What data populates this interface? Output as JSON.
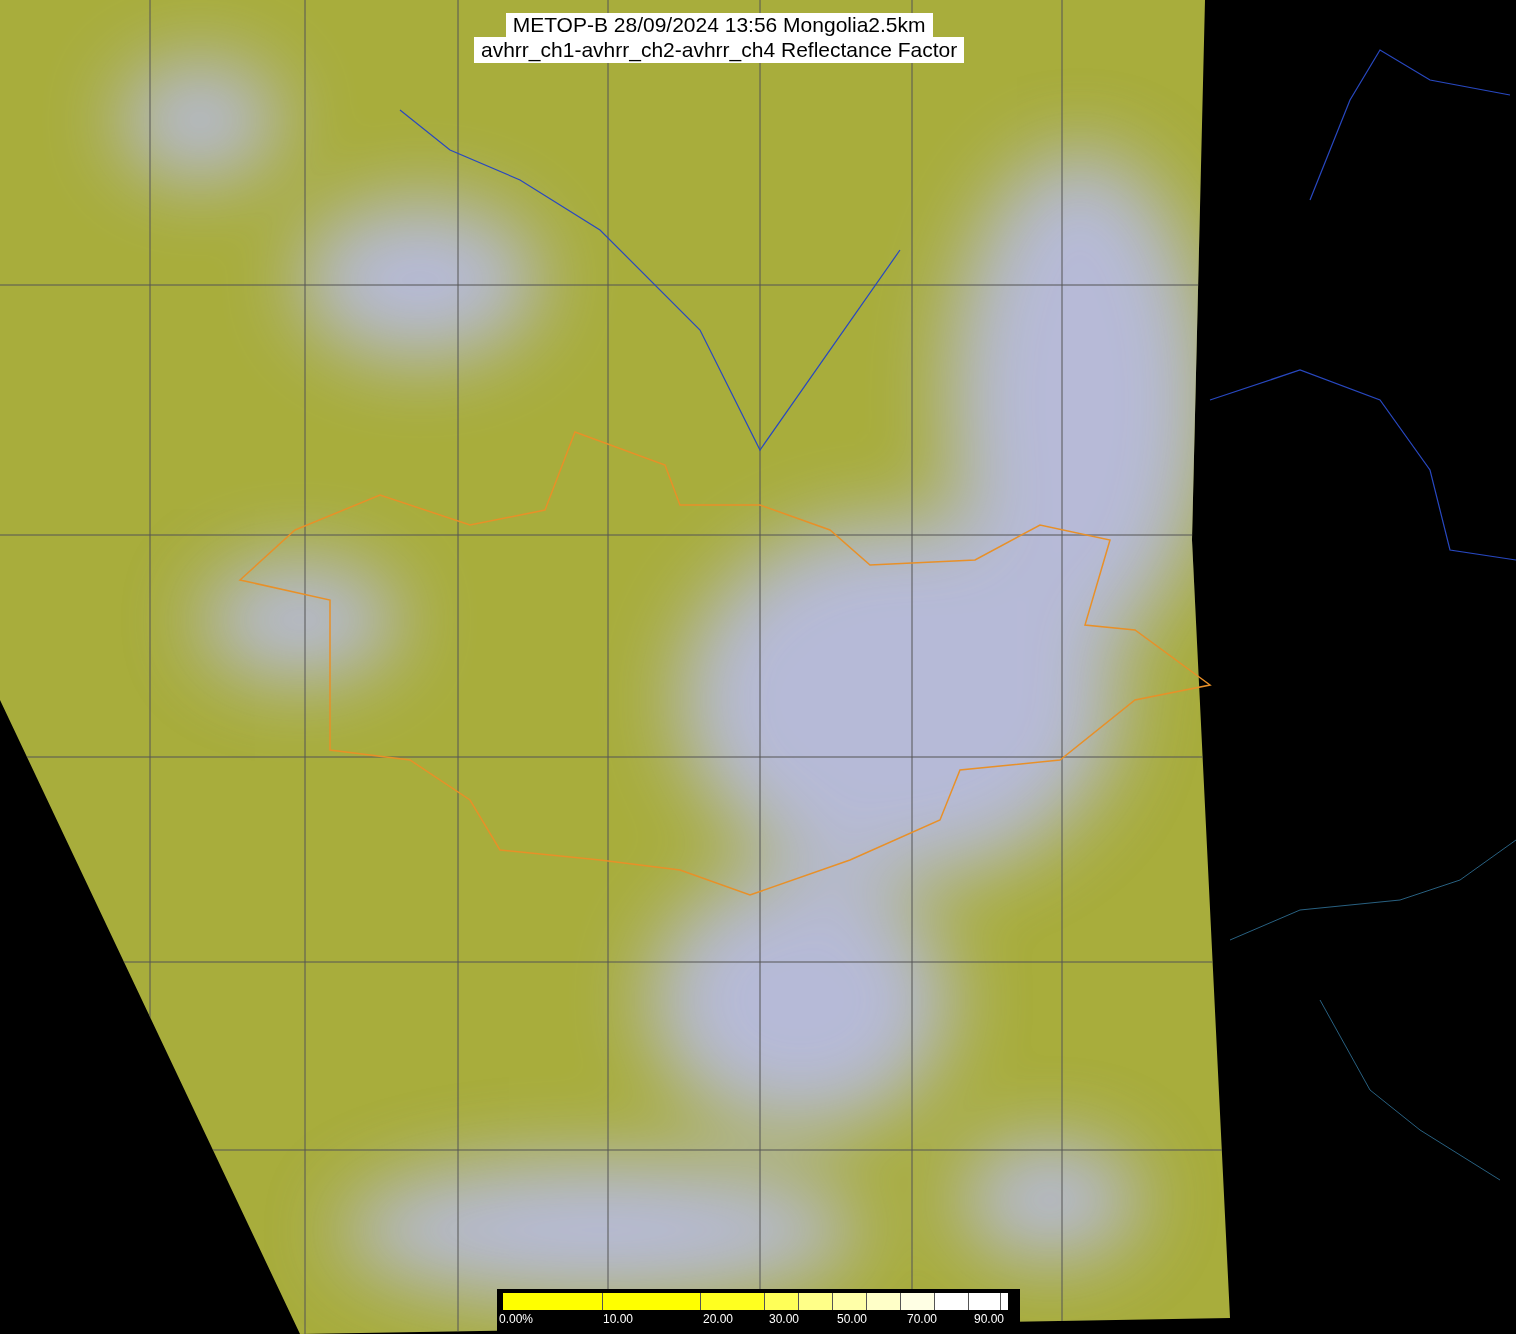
{
  "title": {
    "line_1": "METOP-B 28/09/2024 13:56 Mongolia2.5km",
    "line_2": "avhrr_ch1-avhrr_ch2-avhrr_ch4 Reflectance Factor"
  },
  "colorbar": {
    "segments": [
      {
        "color": "#ffff00"
      },
      {
        "color": "#ffff00"
      },
      {
        "color": "#ffff20"
      },
      {
        "color": "#ffff58"
      },
      {
        "color": "#ffff88"
      },
      {
        "color": "#ffffa8"
      },
      {
        "color": "#ffffc8"
      },
      {
        "color": "#ffffe4"
      },
      {
        "color": "#ffffff"
      },
      {
        "color": "#ffffff"
      }
    ],
    "labels": [
      "0.00%",
      "10.00",
      "20.00",
      "30.00",
      "50.00",
      "70.00",
      "90.00"
    ]
  }
}
